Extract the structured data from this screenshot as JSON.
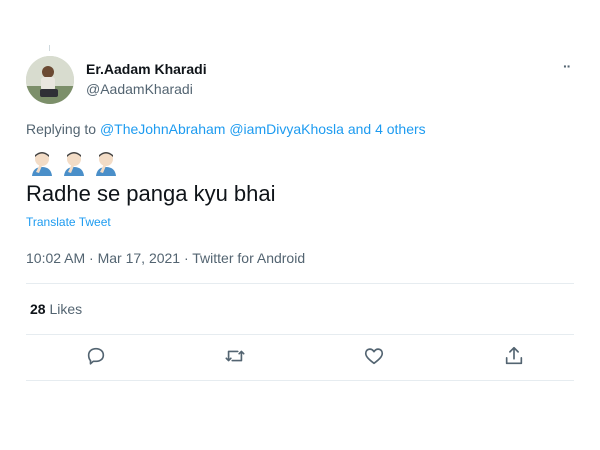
{
  "author": {
    "name": "Er.Aadam Kharadi",
    "handle": "@AadamKharadi"
  },
  "reply": {
    "prefix": "Replying to",
    "mention1": "@TheJohnAbraham",
    "mention2": "@iamDivyaKhosla",
    "connector": "and",
    "others": "4 others"
  },
  "emojis": [
    "man-facepalming-icon",
    "man-facepalming-icon",
    "man-facepalming-icon"
  ],
  "tweet": {
    "text": "Radhe se panga kyu bhai",
    "translate_label": "Translate Tweet",
    "timestamp": "10:02 AM · Mar 17, 2021 · Twitter for Android"
  },
  "stats": {
    "likes_count": "28",
    "likes_label": "Likes"
  },
  "actions": [
    "reply-icon",
    "retweet-icon",
    "like-icon",
    "share-icon"
  ],
  "colors": {
    "accent": "#1d9bf0",
    "text": "#0f1419",
    "secondary": "#536471",
    "divider": "#e6ecf0"
  }
}
